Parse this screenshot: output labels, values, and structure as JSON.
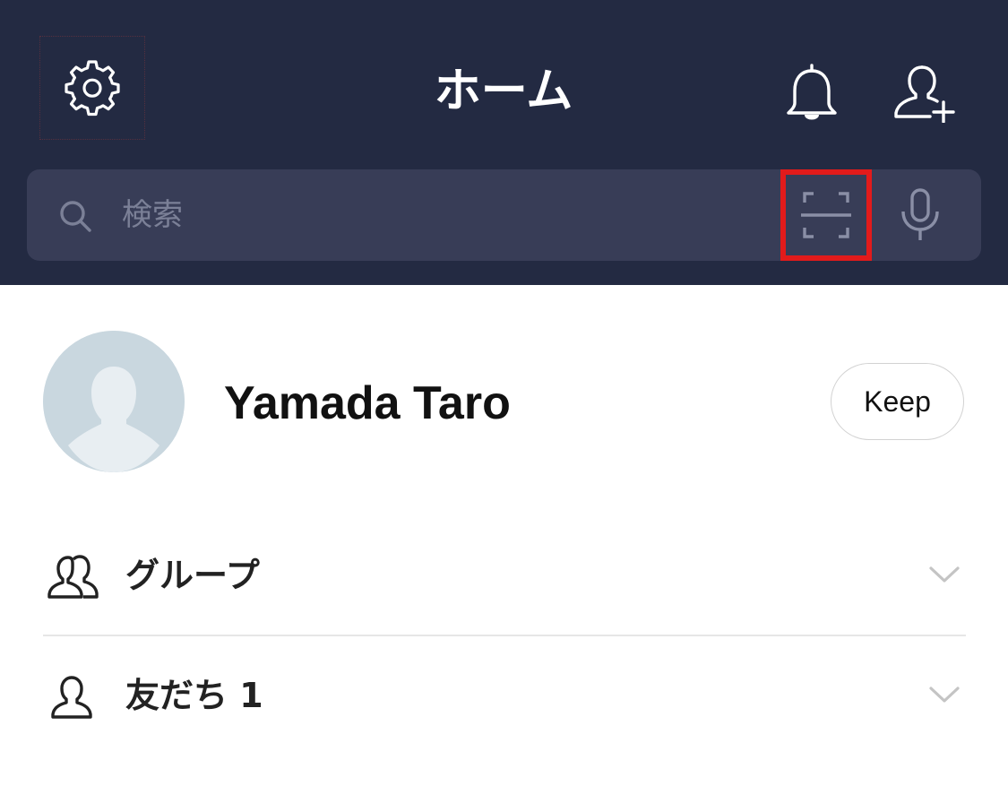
{
  "header": {
    "title": "ホーム",
    "icons": {
      "settings": "gear-icon",
      "notifications": "bell-icon",
      "add_friend": "add-friend-icon"
    },
    "background": "#232a42"
  },
  "search": {
    "placeholder": "検索",
    "icons": {
      "search": "search-icon",
      "qr": "qr-scan-icon",
      "mic": "microphone-icon"
    },
    "highlight_color": "#e21b1b"
  },
  "profile": {
    "name": "Yamada Taro",
    "keep_label": "Keep",
    "avatar": "default-avatar-icon"
  },
  "list": {
    "items": [
      {
        "label": "グループ",
        "icon": "group-icon"
      },
      {
        "label": "友だち 1",
        "icon": "friend-icon"
      }
    ]
  }
}
